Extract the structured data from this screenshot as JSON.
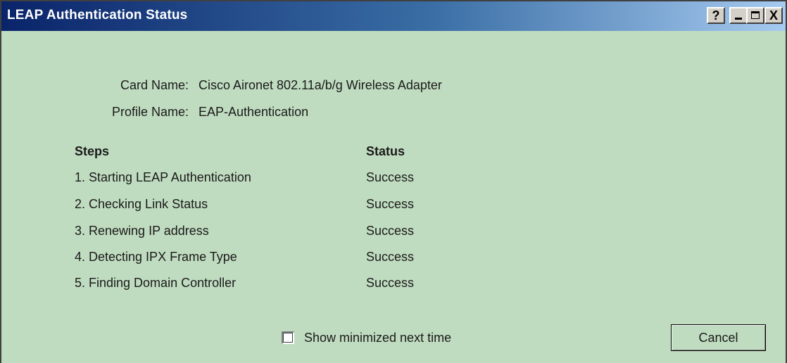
{
  "window": {
    "title": "LEAP Authentication Status",
    "buttons": {
      "help": "?",
      "minimize_icon": "minimize-icon",
      "maximize_icon": "maximize-icon",
      "close": "X"
    },
    "colors": {
      "background": "#c0dcc0",
      "title_start": "#0a246a",
      "title_end": "#a6caf0"
    }
  },
  "info": {
    "card_name_label": "Card Name:",
    "card_name_value": "Cisco Aironet 802.11a/b/g Wireless Adapter",
    "profile_name_label": "Profile Name:",
    "profile_name_value": "EAP-Authentication"
  },
  "table": {
    "headers": {
      "steps": "Steps",
      "status": "Status"
    },
    "rows": [
      {
        "step": "1. Starting LEAP Authentication",
        "status": "Success"
      },
      {
        "step": "2. Checking Link Status",
        "status": "Success"
      },
      {
        "step": "3. Renewing IP address",
        "status": "Success"
      },
      {
        "step": "4. Detecting IPX Frame Type",
        "status": "Success"
      },
      {
        "step": "5. Finding Domain Controller",
        "status": "Success"
      }
    ]
  },
  "footer": {
    "checkbox_label": "Show minimized next time",
    "checkbox_checked": false,
    "cancel_label": "Cancel"
  }
}
